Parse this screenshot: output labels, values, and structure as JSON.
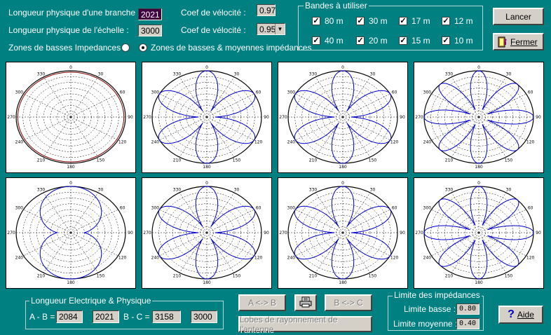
{
  "params": {
    "branch_label": "Longueur physique d'une branche :",
    "branch_value": "2021",
    "ladder_label": "Longueur physique de l'échelle :",
    "ladder_value": "3000",
    "vel1_label": "Coef de vélocité :",
    "vel1_value": "0.97",
    "vel2_label": "Coef de vélocité :",
    "vel2_value": "0.95"
  },
  "zones": {
    "low_label": "Zones de basses Impedances",
    "lowmid_label": "Zones de basses & moyennes impédances",
    "selected": "lowmid"
  },
  "bands": {
    "title": "Bandes à utiliser",
    "items": [
      {
        "label": "80 m",
        "checked": true
      },
      {
        "label": "30 m",
        "checked": true
      },
      {
        "label": "17 m",
        "checked": true
      },
      {
        "label": "12 m",
        "checked": true
      },
      {
        "label": "40 m",
        "checked": true
      },
      {
        "label": "20 m",
        "checked": true
      },
      {
        "label": "15 m",
        "checked": true
      },
      {
        "label": "10 m",
        "checked": true
      }
    ]
  },
  "buttons": {
    "launch": "Lancer",
    "close": "Fermer",
    "ab": "A <-> B",
    "bc": "B <-> C",
    "lobes": "Lobes de rayonnement de l'antenne",
    "help": "Aide"
  },
  "polar": {
    "ticks": [
      "0",
      "30",
      "60",
      "90",
      "120",
      "150",
      "180",
      "210",
      "240",
      "270",
      "300",
      "330"
    ],
    "plots": [
      {
        "lobes": 0
      },
      {
        "lobes": 6
      },
      {
        "lobes": 6
      },
      {
        "lobes": 8
      },
      {
        "lobes": 2
      },
      {
        "lobes": 6
      },
      {
        "lobes": 6
      },
      {
        "lobes": 8
      }
    ],
    "line_color": "#0000cc"
  },
  "lengths": {
    "title": "Longueur Electrique & Physique",
    "ab_label": "A - B =",
    "ab_electric": "2084",
    "ab_physical": "2021",
    "bc_label": "B - C =",
    "bc_electric": "3158",
    "bc_physical": "3000"
  },
  "limits": {
    "title": "Limite des impédances",
    "low_label": "Limite basse :",
    "low_value": "0.80",
    "mid_label": "Limite moyenne :",
    "mid_value": "0.40"
  },
  "icons": {
    "close": "exit-door-icon",
    "print": "printer-icon",
    "help": "question-mark-icon",
    "dropdown": "chevron-down-icon"
  }
}
